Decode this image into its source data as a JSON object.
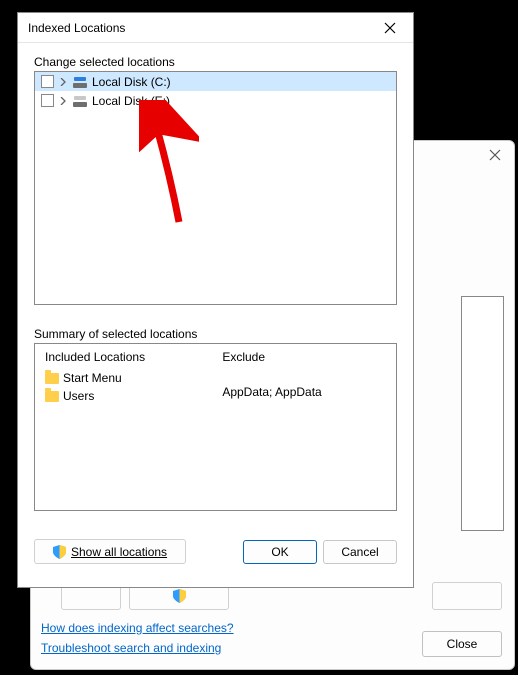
{
  "background_window": {
    "links": {
      "link1": "How does indexing affect searches?",
      "link2": "Troubleshoot search and indexing"
    },
    "close_label": "Close"
  },
  "dialog": {
    "title": "Indexed Locations",
    "change_label": "Change selected locations",
    "tree": {
      "item1": "Local Disk (C:)",
      "item2": "Local Disk (E:)"
    },
    "summary_label": "Summary of selected locations",
    "summary": {
      "included_header": "Included Locations",
      "exclude_header": "Exclude",
      "included1": "Start Menu",
      "included2": "Users",
      "exclude1": "AppData; AppData"
    },
    "show_all_label": "Show all locations",
    "ok_label": "OK",
    "cancel_label": "Cancel"
  }
}
